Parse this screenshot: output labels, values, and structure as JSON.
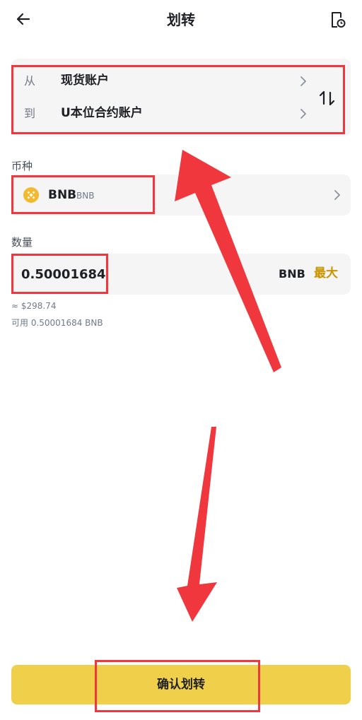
{
  "header": {
    "back_icon": "arrow-left-icon",
    "title": "划转",
    "history_icon": "history-icon"
  },
  "transfer": {
    "from_label": "从",
    "from_account": "现货账户",
    "to_label": "到",
    "to_account": "U本位合约账户",
    "swap_icon": "swap-vertical-icon"
  },
  "coin": {
    "section_label": "币种",
    "symbol": "BNB",
    "name": "BNB",
    "icon": "bnb-coin-icon",
    "icon_color": "#f3ba2f"
  },
  "amount": {
    "section_label": "数量",
    "value": "0.50001684",
    "unit": "BNB",
    "max_label": "最大",
    "usd_estimate": "≈ $298.74",
    "available": "可用 0.50001684 BNB"
  },
  "confirm": {
    "label": "确认划转"
  },
  "colors": {
    "accent": "#f0d04b",
    "max_text": "#c99400",
    "annotation": "#f0373d"
  }
}
